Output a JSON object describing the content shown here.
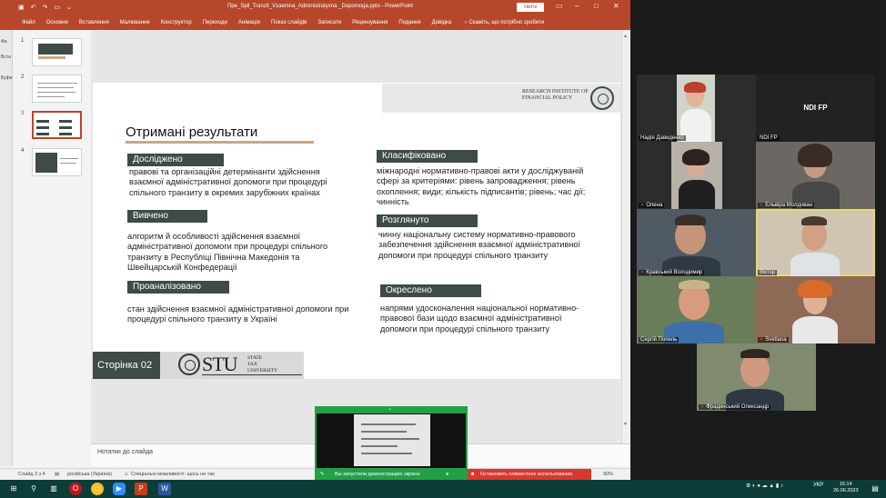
{
  "ppt": {
    "doc_title": "Пре_Spil_Tranzit_Vzaemna_Administratyvna _Dopomoga.pptx - PowerPoint",
    "sign_in": "Увійти",
    "tabs": [
      "Файл",
      "Основне",
      "Вставлення",
      "Малювання",
      "Конструктор",
      "Переходи",
      "Анімація",
      "Показ слайдів",
      "Записати",
      "Рецензування",
      "Подання",
      "Довідка"
    ],
    "tell_me": "Скажіть, що потрібно зробити",
    "left_strip": [
      "Фа",
      "Вста",
      "Буфе"
    ],
    "thumb_numbers": [
      "1",
      "2",
      "3",
      "4"
    ],
    "notes_placeholder": "Нотатки до слайда",
    "status": {
      "slide": "Слайд 3 з 4",
      "lang": "російська (Україна)",
      "access": "Спеціальні можливості: щось не так",
      "zoom": "90%"
    }
  },
  "slide": {
    "institute": "RESEARCH INSTITUTE OF FINANCIAL POLICY",
    "title": "Отримані результати",
    "left": [
      {
        "label": "Досліджено",
        "text": "правові та організаційні детермінанти здійснення взаємної адміністративної допомоги при процедурі спільного транзиту в окремих зарубіжних країнах"
      },
      {
        "label": "Вивчено",
        "text": "алгоритм й особливості здійснення взаємної адміністративної допомоги при процедурі спільного транзиту в Республіці Північна Македонія та Швейцарській Конфедерації"
      },
      {
        "label": "Проаналізовано",
        "text": "стан здійснення взаємної адміністративної допомоги при процедурі спільного транзиту в Україні"
      }
    ],
    "right": [
      {
        "label": "Класифіковано",
        "text": "міжнародні нормативно-правові акти у досліджуваній сфері за критеріями: рівень запровадження; рівень охоплення; види; кількість підписантів; рівень; час дії; чинність"
      },
      {
        "label": "Розглянуто",
        "text": "чинну національну систему нормативно-правового забезпечення здійснення взаємної адміністративної допомоги при процедурі спільного транзиту"
      },
      {
        "label": "Окреслено",
        "text": "напрями удосконалення національної нормативно-правової бази щодо взаємної адміністративної допомоги при процедурі спільного транзиту"
      }
    ],
    "page_label": "Сторінка",
    "page_num": "02",
    "stu_letters": "STU",
    "stu_words": [
      "STATE",
      "TAX",
      "UNIVERSITY"
    ]
  },
  "share": {
    "notice": "Вы запустили демонстрацию экрана",
    "stop": "Остановить совместное использование"
  },
  "gallery": {
    "participants": [
      {
        "name": "Надія Давиденко",
        "mic_off": false
      },
      {
        "name": "NDI FP",
        "mic_off": false,
        "big_label": "NDI FP"
      },
      {
        "name": "Олена",
        "mic_off": true
      },
      {
        "name": "Ельвіра Молдован",
        "mic_off": true
      },
      {
        "name": "Кравський Володимир",
        "mic_off": true
      },
      {
        "name": "Віктор",
        "mic_off": false
      },
      {
        "name": "Сергій Попель",
        "mic_off": false
      },
      {
        "name": "Svetlana",
        "mic_off": true
      },
      {
        "name": "Фрадинський Олександр",
        "mic_off": true
      }
    ]
  },
  "taskbar": {
    "lang": "УКР",
    "time": "15:14",
    "date": "26.06.2023"
  },
  "colors": {
    "ppt_red": "#b7472a",
    "slide_green": "#3e4b47",
    "accent_tan": "#c8a886",
    "share_green": "#23a047",
    "stop_red": "#d8382e",
    "taskbar": "#0d3d38"
  }
}
